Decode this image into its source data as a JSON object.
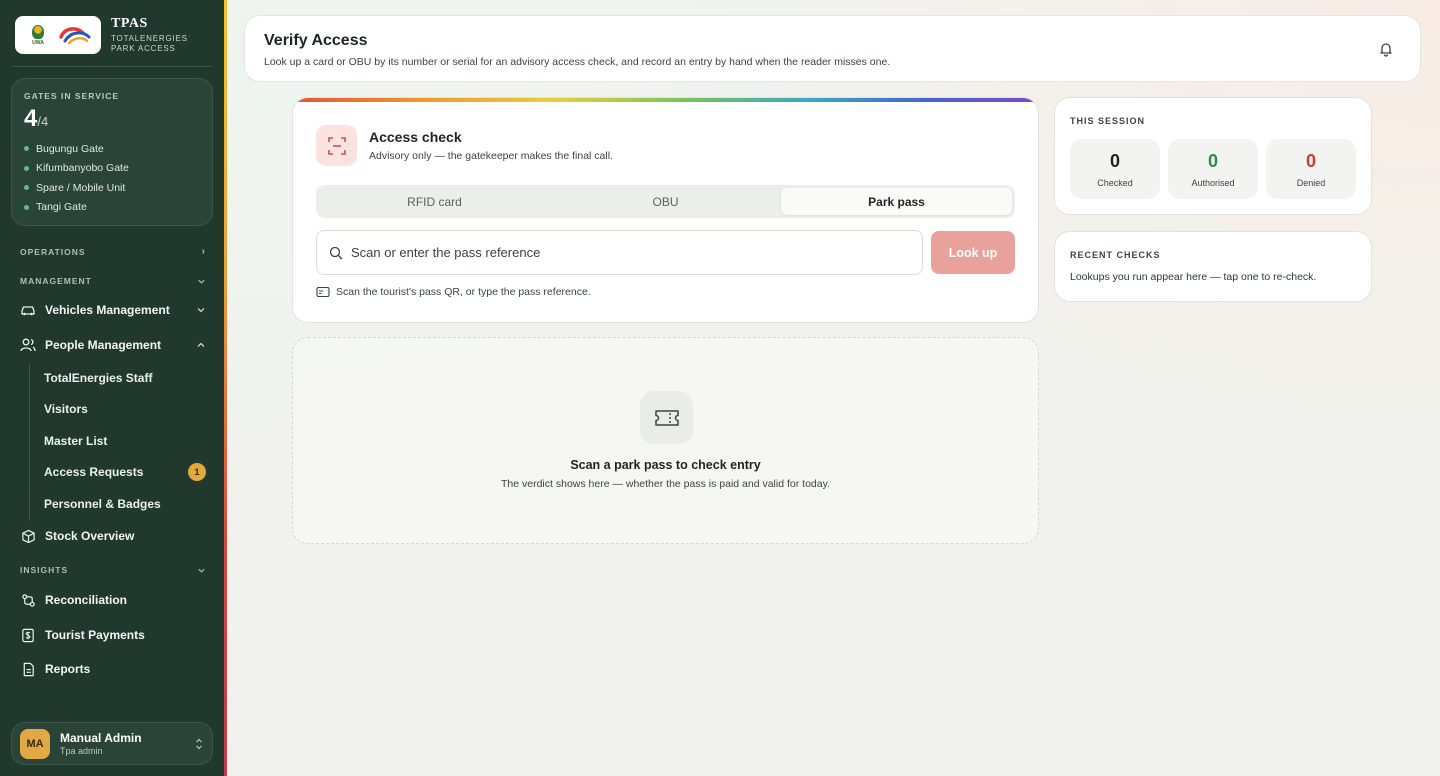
{
  "brand": {
    "title": "TPAS",
    "subtitle_line1": "TOTALENERGIES",
    "subtitle_line2": "PARK ACCESS",
    "uwa_logo_text": "UWA"
  },
  "gates": {
    "label": "GATES IN SERVICE",
    "count": "4",
    "total": "/4",
    "list": [
      "Bugungu Gate",
      "Kifumbanyobo Gate",
      "Spare / Mobile Unit",
      "Tangi Gate"
    ]
  },
  "nav": {
    "operations_label": "OPERATIONS",
    "management_label": "MANAGEMENT",
    "vehicles": "Vehicles Management",
    "people": "People Management",
    "people_sub": [
      "TotalEnergies Staff",
      "Visitors",
      "Master List",
      "Access Requests",
      "Personnel & Badges"
    ],
    "access_requests_badge": "1",
    "stock": "Stock Overview",
    "insights_label": "INSIGHTS",
    "reconciliation": "Reconciliation",
    "tourist_payments": "Tourist Payments",
    "reports": "Reports"
  },
  "user": {
    "initials": "MA",
    "name": "Manual Admin",
    "role": "Tpa admin"
  },
  "header": {
    "title": "Verify Access",
    "description": "Look up a card or OBU by its number or serial for an advisory access check, and record an entry by hand when the reader misses one."
  },
  "access_check": {
    "title": "Access check",
    "subtitle": "Advisory only — the gatekeeper makes the final call.",
    "tabs": [
      "RFID card",
      "OBU",
      "Park pass"
    ],
    "active_tab": "Park pass",
    "search_placeholder": "Scan or enter the pass reference",
    "lookup_label": "Look up",
    "hint": "Scan the tourist's pass QR, or type the pass reference."
  },
  "empty_state": {
    "title": "Scan a park pass to check entry",
    "description": "The verdict shows here — whether the pass is paid and valid for today."
  },
  "session": {
    "label": "THIS SESSION",
    "stats": [
      {
        "value": "0",
        "label": "Checked"
      },
      {
        "value": "0",
        "label": "Authorised"
      },
      {
        "value": "0",
        "label": "Denied"
      }
    ]
  },
  "recent": {
    "label": "RECENT CHECKS",
    "description": "Lookups you run appear here — tap one to re-check."
  },
  "colors": {
    "sidebar_bg": "#21382d",
    "accent_red": "#e8a19b",
    "authorised_green": "#2e8a4c",
    "denied_red": "#d03b34",
    "badge": "#e1a83a"
  }
}
